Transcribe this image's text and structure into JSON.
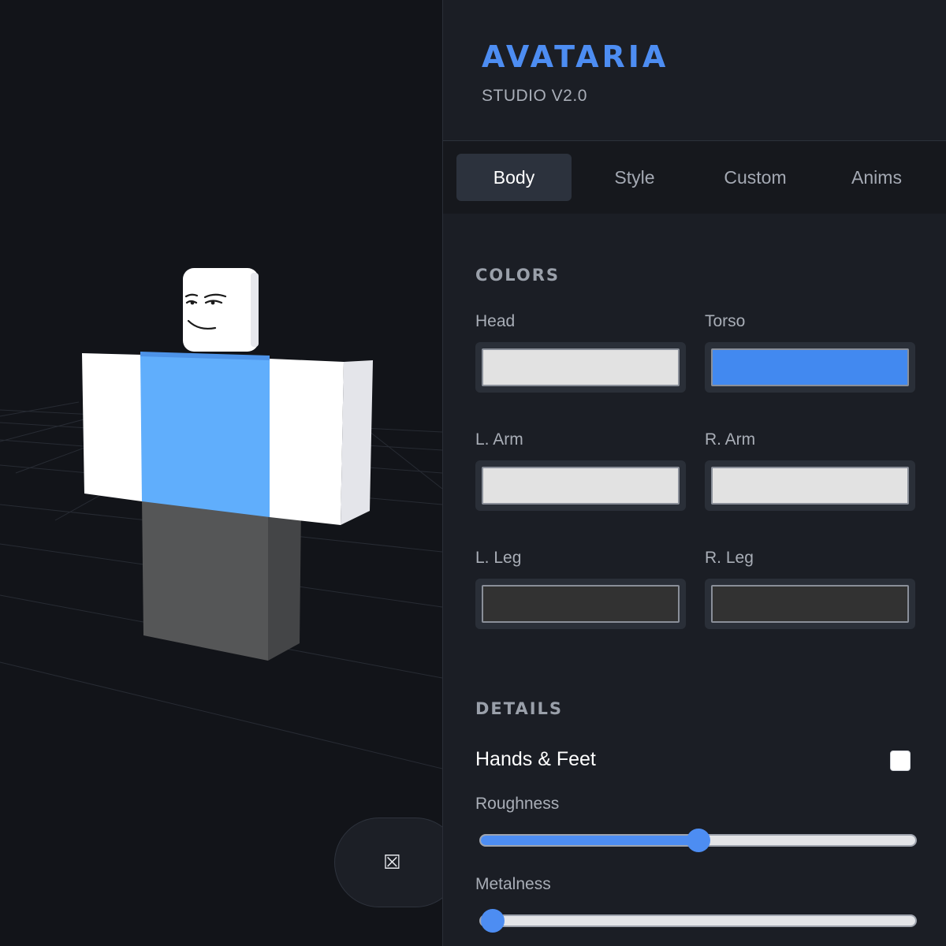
{
  "brand": {
    "title": "AVATARIA",
    "subtitle": "STUDIO V2.0"
  },
  "tabs": [
    {
      "label": "Body",
      "active": true
    },
    {
      "label": "Style",
      "active": false
    },
    {
      "label": "Custom",
      "active": false
    },
    {
      "label": "Anims",
      "active": false
    }
  ],
  "colors": {
    "title": "COLORS",
    "items": [
      {
        "label": "Head",
        "color": "#e2e2e2"
      },
      {
        "label": "Torso",
        "color": "#4289f0"
      },
      {
        "label": "L. Arm",
        "color": "#e2e2e2"
      },
      {
        "label": "R. Arm",
        "color": "#e2e2e2"
      },
      {
        "label": "L. Leg",
        "color": "#323232"
      },
      {
        "label": "R. Leg",
        "color": "#323232"
      }
    ]
  },
  "details": {
    "title": "DETAILS",
    "hands_feet": {
      "label": "Hands & Feet",
      "checked": false
    },
    "roughness": {
      "label": "Roughness",
      "value": 0.5
    },
    "metalness": {
      "label": "Metalness",
      "value": 0.0
    }
  },
  "viewport": {
    "toggle_icon": "camera-icon",
    "toggle_glyph": "⮽"
  },
  "theme": {
    "accent": "#4d8df2",
    "panel_bg": "#1b1e25",
    "viewport_bg": "#121419"
  }
}
